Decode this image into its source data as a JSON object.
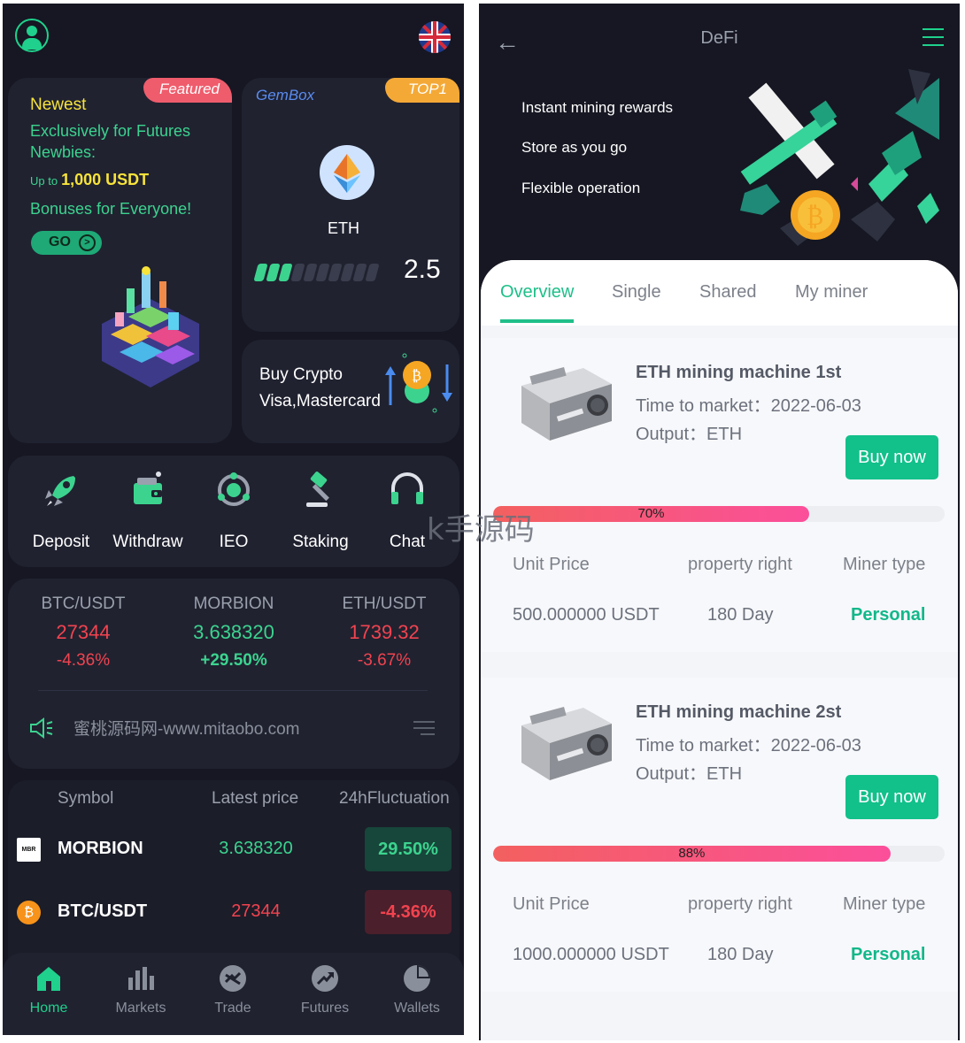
{
  "left": {
    "promo": {
      "tag": "Featured",
      "newest": "Newest",
      "line1": "Exclusively for Futures Newbies:",
      "upto_prefix": "Up to",
      "upto_amount": "1,000 USDT",
      "bonus": "Bonuses for Everyone!",
      "go": "GO"
    },
    "gembox": {
      "brand": "GemBox",
      "tag": "TOP1",
      "coin": "ETH",
      "value": "2.5",
      "level_bars_on": 3,
      "level_bars_total": 10
    },
    "buy": {
      "line1": "Buy Crypto",
      "line2": "Visa,Mastercard"
    },
    "actions": [
      "Deposit",
      "Withdraw",
      "IEO",
      "Staking",
      "Chat"
    ],
    "tickers": [
      {
        "symbol": "BTC/USDT",
        "price": "27344",
        "change": "-4.36%",
        "dir": "down"
      },
      {
        "symbol": "MORBION",
        "price": "3.638320",
        "change": "+29.50%",
        "dir": "up"
      },
      {
        "symbol": "ETH/USDT",
        "price": "1739.32",
        "change": "-3.67%",
        "dir": "down"
      }
    ],
    "notice": "蜜桃源码网-www.mitaobo.com",
    "market": {
      "headers": [
        "Symbol",
        "Latest price",
        "24hFluctuation"
      ],
      "rows": [
        {
          "name": "MORBION",
          "price": "3.638320",
          "change": "29.50%",
          "dir": "up",
          "logo_text": "MBR"
        },
        {
          "name": "BTC/USDT",
          "price": "27344",
          "change": "-4.36%",
          "dir": "down",
          "logo_text": "₿"
        }
      ]
    },
    "tabs": [
      "Home",
      "Markets",
      "Trade",
      "Futures",
      "Wallets"
    ]
  },
  "right": {
    "title": "DeFi",
    "features": [
      "Instant mining rewards",
      "Store as you go",
      "Flexible operation"
    ],
    "tabs": [
      "Overview",
      "Single",
      "Shared",
      "My miner"
    ],
    "machines": [
      {
        "title": "ETH mining machine 1st",
        "market_label": "Time to market：",
        "market_date": "2022-06-03",
        "output_label": "Output：",
        "output": "ETH",
        "buy": "Buy now",
        "progress_label": "70%",
        "progress": 0.7,
        "col_labels": [
          "Unit Price",
          "property right",
          "Miner type"
        ],
        "unit_price": "500.000000 USDT",
        "property": "180 Day",
        "type": "Personal"
      },
      {
        "title": "ETH mining machine 2st",
        "market_label": "Time to market：",
        "market_date": "2022-06-03",
        "output_label": "Output：",
        "output": "ETH",
        "buy": "Buy now",
        "progress_label": "88%",
        "progress": 0.88,
        "col_labels": [
          "Unit Price",
          "property right",
          "Miner type"
        ],
        "unit_price": "1000.000000 USDT",
        "property": "180 Day",
        "type": "Personal"
      }
    ]
  },
  "watermark": "k手源码",
  "colors": {
    "accent": "#1fd18c",
    "up": "#3cd38f",
    "down": "#f1434f",
    "buy": "#12c08a"
  }
}
